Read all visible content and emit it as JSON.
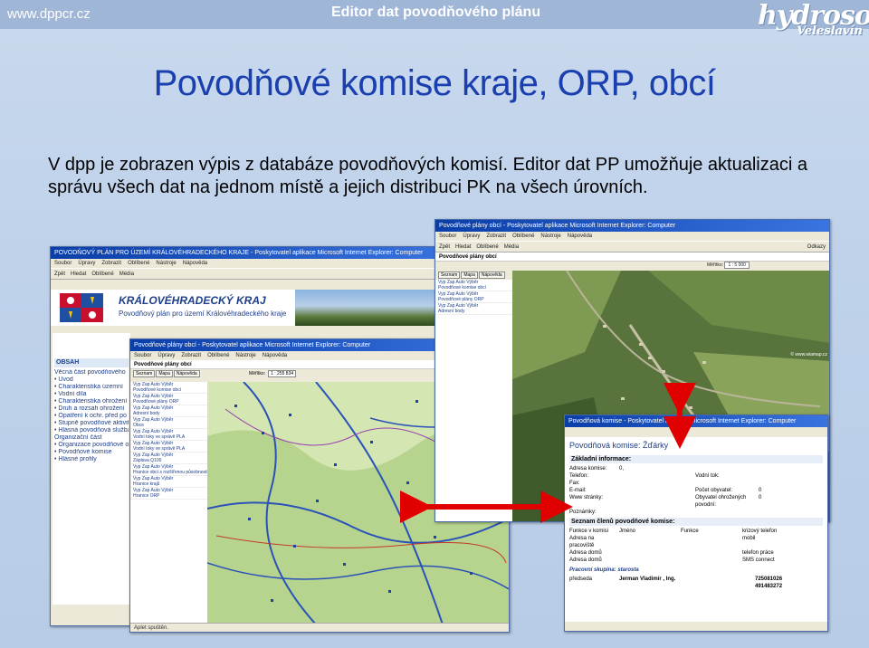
{
  "slide": {
    "site": "www.dppcr.cz",
    "editor_title": "Editor dat povodňového plánu",
    "logo_main": "hydrosoft",
    "logo_sub": "Veleslavín",
    "heading": "Povodňové komise kraje, ORP, obcí",
    "paragraph": "V dpp  je zobrazen výpis z databáze povodňových komisí. Editor dat PP umožňuje aktualizaci a správu všech dat na jednom místě a jejich distribuci PK na všech úrovních."
  },
  "colors": {
    "heading": "#1a3fae",
    "arrow": "#e00000",
    "ie_titlebar": "#0a3ea8"
  },
  "win1": {
    "title": "POVODŇOVÝ PLÁN PRO ÚZEMÍ KRÁLOVÉHRADECKÉHO KRAJE - Poskytovatel aplikace Microsoft Internet Explorer: Computer",
    "menu": [
      "Soubor",
      "Úpravy",
      "Zobrazit",
      "Oblíbené",
      "Nástroje",
      "Nápověda"
    ],
    "toolbar": [
      "Zpět",
      "Hledat",
      "Oblíbené",
      "Média"
    ],
    "kraj_title": "KRÁLOVÉHRADECKÝ KRAJ",
    "kraj_sub": "Povodňový plán pro území Královéhradeckého kraje",
    "nav_header": "OBSAH",
    "nav_items": [
      "Věcná část povodňového",
      "• Úvod",
      "• Charakteristika územní",
      "• Vodní díla",
      "• Charakteristika ohrožení",
      "• Druh a rozsah ohrožení",
      "• Opatření k ochr. před po",
      "• Stupně povodňové aktivity",
      "• Hlásná povodňová služba",
      "Organizační část",
      "• Organizace povodňové o",
      "• Povodňové komise",
      "",
      "",
      "",
      "",
      "",
      "",
      "",
      "",
      "",
      "",
      "",
      "",
      "",
      "",
      "",
      "",
      "",
      "",
      "",
      "• Hlásné profily"
    ]
  },
  "win2": {
    "title": "Povodňové plány obcí - Poskytovatel aplikace Microsoft Internet Explorer: Computer",
    "menu": [
      "Soubor",
      "Úpravy",
      "Zobrazit",
      "Oblíbené",
      "Nástroje",
      "Nápověda"
    ],
    "toolbar": [
      "Zpět",
      "Hledat",
      "Oblíbené",
      "Média"
    ],
    "page_title": "Povodňové plány obcí",
    "tabs": [
      "Seznam",
      "Mapa",
      "Nápověda"
    ],
    "layers": [
      {
        "ctl": "Vyp Zap Auto  Výběr",
        "name": "Povodňové komise obcí"
      },
      {
        "ctl": "Vyp Zap Auto  Výběr",
        "name": "Povodňové plány ORP"
      },
      {
        "ctl": "Vyp Zap Auto  Výběr",
        "name": "Adresní body"
      },
      {
        "ctl": "Vyp Zap Auto  Výběr",
        "name": "Obce"
      },
      {
        "ctl": "Vyp Zap Auto  Výběr",
        "name": "Vodní toky ve správě PLA"
      },
      {
        "ctl": "Vyp Zap Auto  Výběr",
        "name": "Vodní toky ve správě PLA"
      },
      {
        "ctl": "Vyp Zap Auto  Výběr",
        "name": "Záplava Q100"
      },
      {
        "ctl": "Vyp Zap Auto  Výběr",
        "name": "Hranice obcí s rozšířenou působností"
      },
      {
        "ctl": "Vyp Zap Auto  Výběr",
        "name": "Hranice krajů"
      },
      {
        "ctl": "Vyp Zap Auto  Výběr",
        "name": "Hranice ORP"
      }
    ],
    "scale_label": "Měřítko:",
    "scale_value": "1 : 255 834",
    "status": "Aplet spuštěn."
  },
  "win3": {
    "title": "Povodňové plány obcí - Poskytovatel aplikace Microsoft Internet Explorer: Computer",
    "menu": [
      "Soubor",
      "Úpravy",
      "Zobrazit",
      "Oblíbené",
      "Nástroje",
      "Nápověda"
    ],
    "toolbar": [
      "Zpět",
      "Hledat",
      "Oblíbené",
      "Média"
    ],
    "address": "Odkazy",
    "page_title": "Povodňové plány obcí",
    "tabs": [
      "Seznam",
      "Mapa",
      "Nápověda"
    ],
    "layers": [
      {
        "ctl": "Vyp Zap Auto  Výběr",
        "name": "Povodňové komise obcí"
      },
      {
        "ctl": "Vyp Zap Auto  Výběr",
        "name": "Povodňové plány ORP"
      },
      {
        "ctl": "Vyp Zap Auto  Výběr",
        "name": "Adresní body"
      }
    ],
    "scale_label": "Měřítko:",
    "scale_value": "1 : 5 000",
    "copyright": "© www.wiamap.cz"
  },
  "win4": {
    "title": "Povodňová komise - Poskytovatel aplikace Microsoft Internet Explorer: Computer",
    "komise_title": "Povodňová komise: Žďárky",
    "basic_header": "Základní informace:",
    "basic_rows": [
      [
        "Adresa komise:",
        "0,",
        "",
        ""
      ],
      [
        "Telefon:",
        "",
        "Vodní tok:",
        ""
      ],
      [
        "Fax:",
        "",
        "",
        ""
      ],
      [
        "E-mail:",
        "",
        "Počet obyvatel:",
        "0"
      ],
      [
        "Www stránky:",
        "",
        "Obyvatel ohrožených povodní:",
        "0"
      ],
      [
        "Poznámky:",
        "",
        "",
        ""
      ]
    ],
    "members_header": "Seznam členů povodňové komise:",
    "member_rows": [
      [
        "Funkce v komisi",
        "Jméno",
        "Funkce",
        "krizový telefon"
      ],
      [
        "Adresa na pracoviště",
        "",
        "",
        "mobil"
      ],
      [
        "Adresa domů",
        "",
        "",
        "telefon práce"
      ],
      [
        "Adresa domů",
        "",
        "",
        "SMS connect"
      ]
    ],
    "group_label": "Pracovní skupina: starosta",
    "chair_role": "předseda",
    "chair_name": "Jerman Vladimír , Ing.",
    "phone1": "725081026",
    "phone2": "491483272"
  }
}
